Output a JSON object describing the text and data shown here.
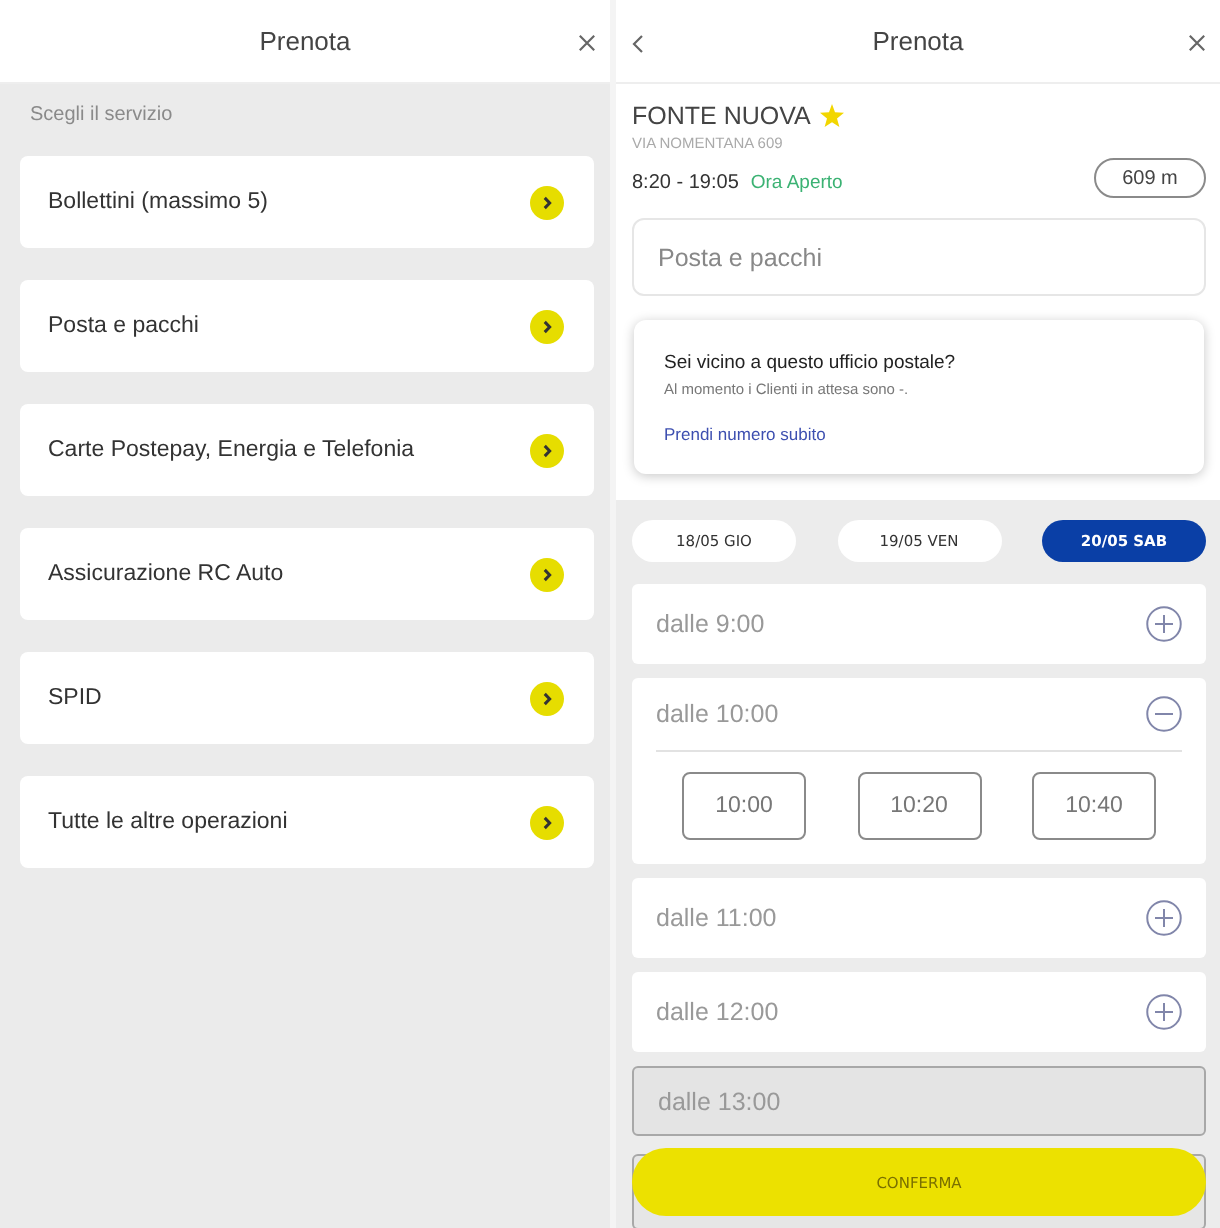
{
  "left_panel": {
    "header": {
      "title": "Prenota"
    },
    "section_label": "Scegli il servizio",
    "services": [
      {
        "label": "Bollettini (massimo 5)"
      },
      {
        "label": "Posta e pacchi"
      },
      {
        "label": "Carte Postepay, Energia e Telefonia"
      },
      {
        "label": "Assicurazione RC Auto"
      },
      {
        "label": "SPID"
      },
      {
        "label": "Tutte le altre operazioni"
      }
    ]
  },
  "right_panel": {
    "header": {
      "title": "Prenota"
    },
    "office": {
      "name": "FONTE NUOVA",
      "favorite": true,
      "address": "VIA NOMENTANA 609",
      "hours": "8:20 - 19:05",
      "status": "Ora Aperto",
      "distance": "609 m"
    },
    "service_field": {
      "value": "Posta e pacchi"
    },
    "notice": {
      "title": "Sei vicino a questo ufficio postale?",
      "text": "Al momento i Clienti in attesa sono -.",
      "link": "Prendi numero subito"
    },
    "dates": [
      {
        "label": "18/05 GIO",
        "selected": false
      },
      {
        "label": "19/05 VEN",
        "selected": false
      },
      {
        "label": "20/05 SAB",
        "selected": true
      }
    ],
    "slots": [
      {
        "label": "dalle 9:00",
        "expanded": false,
        "disabled": false
      },
      {
        "label": "dalle 10:00",
        "expanded": true,
        "disabled": false,
        "times": [
          "10:00",
          "10:20",
          "10:40"
        ]
      },
      {
        "label": "dalle 11:00",
        "expanded": false,
        "disabled": false
      },
      {
        "label": "dalle 12:00",
        "expanded": false,
        "disabled": false
      },
      {
        "label": "dalle 13:00",
        "expanded": false,
        "disabled": true
      }
    ],
    "confirm_button": {
      "label": "CONFERMA",
      "disabled": true
    }
  }
}
